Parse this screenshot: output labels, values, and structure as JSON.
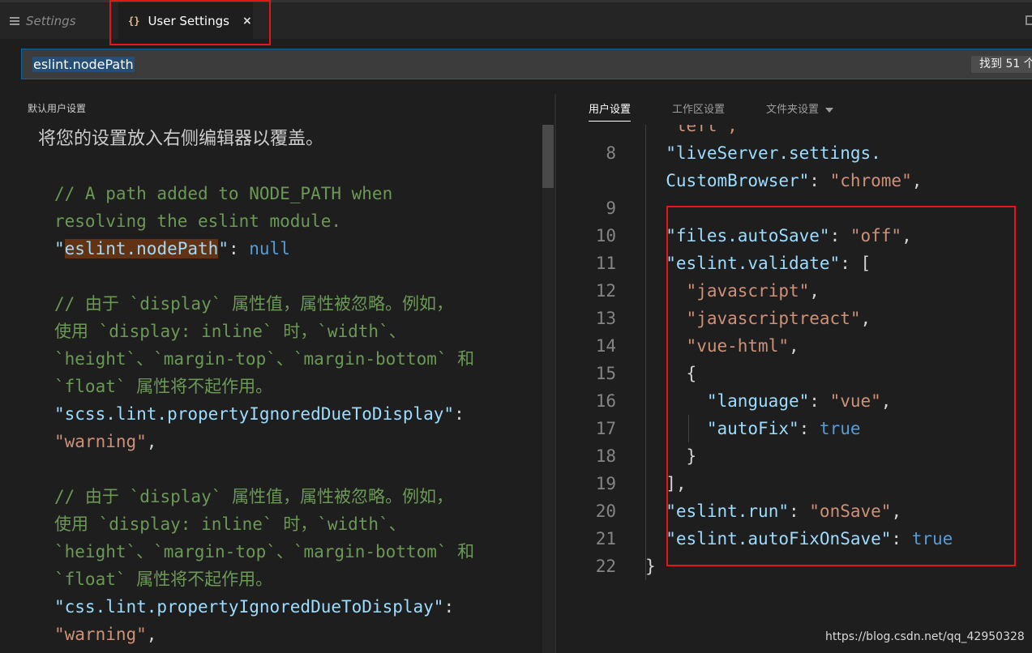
{
  "tabs": {
    "settings_label": "Settings",
    "user_settings_label": "User Settings",
    "braces_icon": "{}",
    "close_glyph": "×"
  },
  "search": {
    "value": "eslint.nodePath",
    "found_badge": "找到 51 个"
  },
  "left_pane": {
    "title": "默认用户设置",
    "hint": "将您的设置放入右侧编辑器以覆盖。",
    "lines": [
      [
        {
          "t": "// A path added to NODE_PATH when",
          "c": "cm"
        }
      ],
      [
        {
          "t": "resolving the eslint module.",
          "c": "cm"
        }
      ],
      [
        {
          "t": "\"",
          "c": "key"
        },
        {
          "t": "eslint.nodePath",
          "c": "key match"
        },
        {
          "t": "\"",
          "c": "key"
        },
        {
          "t": ": ",
          "c": "pun"
        },
        {
          "t": "null",
          "c": "kw"
        }
      ],
      [],
      [
        {
          "t": "// 由于 `display` 属性值，属性被忽略。例如，",
          "c": "cm"
        }
      ],
      [
        {
          "t": "使用 `display: inline` 时，`width`、",
          "c": "cm"
        }
      ],
      [
        {
          "t": "`height`、`margin-top`、`margin-bottom` 和",
          "c": "cm"
        }
      ],
      [
        {
          "t": "`float` 属性将不起作用。",
          "c": "cm"
        }
      ],
      [
        {
          "t": "\"scss.lint.propertyIgnoredDueToDisplay\"",
          "c": "key"
        },
        {
          "t": ":",
          "c": "pun"
        }
      ],
      [
        {
          "t": "\"warning\"",
          "c": "str"
        },
        {
          "t": ",",
          "c": "pun"
        }
      ],
      [],
      [
        {
          "t": "// 由于 `display` 属性值，属性被忽略。例如，",
          "c": "cm"
        }
      ],
      [
        {
          "t": "使用 `display: inline` 时，`width`、",
          "c": "cm"
        }
      ],
      [
        {
          "t": "`height`、`margin-top`、`margin-bottom` 和",
          "c": "cm"
        }
      ],
      [
        {
          "t": "`float` 属性将不起作用。",
          "c": "cm"
        }
      ],
      [
        {
          "t": "\"css.lint.propertyIgnoredDueToDisplay\"",
          "c": "key"
        },
        {
          "t": ":",
          "c": "pun"
        }
      ],
      [
        {
          "t": "\"warning\"",
          "c": "str"
        },
        {
          "t": ",",
          "c": "pun"
        }
      ]
    ]
  },
  "right_tabs": {
    "user": "用户设置",
    "workspace": "工作区设置",
    "folder": "文件夹设置"
  },
  "editor_lines": [
    {
      "n": "",
      "indent": 1,
      "tokens": [
        {
          "t": "\"left\",",
          "c": "str"
        }
      ]
    },
    {
      "n": "8",
      "indent": 1,
      "tokens": [
        {
          "t": "\"liveServer.settings.",
          "c": "key"
        }
      ]
    },
    {
      "n": "",
      "indent": 1,
      "tokens": [
        {
          "t": "CustomBrowser\"",
          "c": "key"
        },
        {
          "t": ": ",
          "c": "pun"
        },
        {
          "t": "\"chrome\"",
          "c": "str"
        },
        {
          "t": ",",
          "c": "pun"
        }
      ]
    },
    {
      "n": "9",
      "indent": 1,
      "tokens": []
    },
    {
      "n": "10",
      "indent": 1,
      "tokens": [
        {
          "t": "\"files.autoSave\"",
          "c": "key"
        },
        {
          "t": ": ",
          "c": "pun"
        },
        {
          "t": "\"off\"",
          "c": "str"
        },
        {
          "t": ",",
          "c": "pun"
        }
      ]
    },
    {
      "n": "11",
      "indent": 1,
      "tokens": [
        {
          "t": "\"eslint.validate\"",
          "c": "key"
        },
        {
          "t": ": [",
          "c": "pun"
        }
      ]
    },
    {
      "n": "12",
      "indent": 2,
      "tokens": [
        {
          "t": "\"javascript\"",
          "c": "str"
        },
        {
          "t": ",",
          "c": "pun"
        }
      ]
    },
    {
      "n": "13",
      "indent": 2,
      "tokens": [
        {
          "t": "\"javascriptreact\"",
          "c": "str"
        },
        {
          "t": ",",
          "c": "pun"
        }
      ]
    },
    {
      "n": "14",
      "indent": 2,
      "tokens": [
        {
          "t": "\"vue-html\"",
          "c": "str"
        },
        {
          "t": ",",
          "c": "pun"
        }
      ]
    },
    {
      "n": "15",
      "indent": 2,
      "tokens": [
        {
          "t": "{",
          "c": "pun"
        }
      ]
    },
    {
      "n": "16",
      "indent": 3,
      "tokens": [
        {
          "t": "\"language\"",
          "c": "key"
        },
        {
          "t": ": ",
          "c": "pun"
        },
        {
          "t": "\"vue\"",
          "c": "str"
        },
        {
          "t": ",",
          "c": "pun"
        }
      ]
    },
    {
      "n": "17",
      "indent": 3,
      "tokens": [
        {
          "t": "\"autoFix\"",
          "c": "key"
        },
        {
          "t": ": ",
          "c": "pun"
        },
        {
          "t": "true",
          "c": "kw"
        }
      ]
    },
    {
      "n": "18",
      "indent": 2,
      "tokens": [
        {
          "t": "}",
          "c": "pun"
        }
      ]
    },
    {
      "n": "19",
      "indent": 1,
      "tokens": [
        {
          "t": "],",
          "c": "pun"
        }
      ]
    },
    {
      "n": "20",
      "indent": 1,
      "tokens": [
        {
          "t": "\"eslint.run\"",
          "c": "key"
        },
        {
          "t": ": ",
          "c": "pun"
        },
        {
          "t": "\"onSave\"",
          "c": "str"
        },
        {
          "t": ",",
          "c": "pun"
        }
      ]
    },
    {
      "n": "21",
      "indent": 1,
      "tokens": [
        {
          "t": "\"eslint.autoFixOnSave\"",
          "c": "key"
        },
        {
          "t": ": ",
          "c": "pun"
        },
        {
          "t": "true",
          "c": "kw"
        }
      ]
    },
    {
      "n": "22",
      "indent": 0,
      "tokens": [
        {
          "t": "}",
          "c": "pun"
        }
      ]
    }
  ],
  "watermark": "https://blog.csdn.net/qq_42950328",
  "colors": {
    "highlight_box": "#e51616",
    "comment": "#6a9955",
    "property_key": "#9cdcfe",
    "string": "#ce9178",
    "keyword": "#569cd6"
  }
}
